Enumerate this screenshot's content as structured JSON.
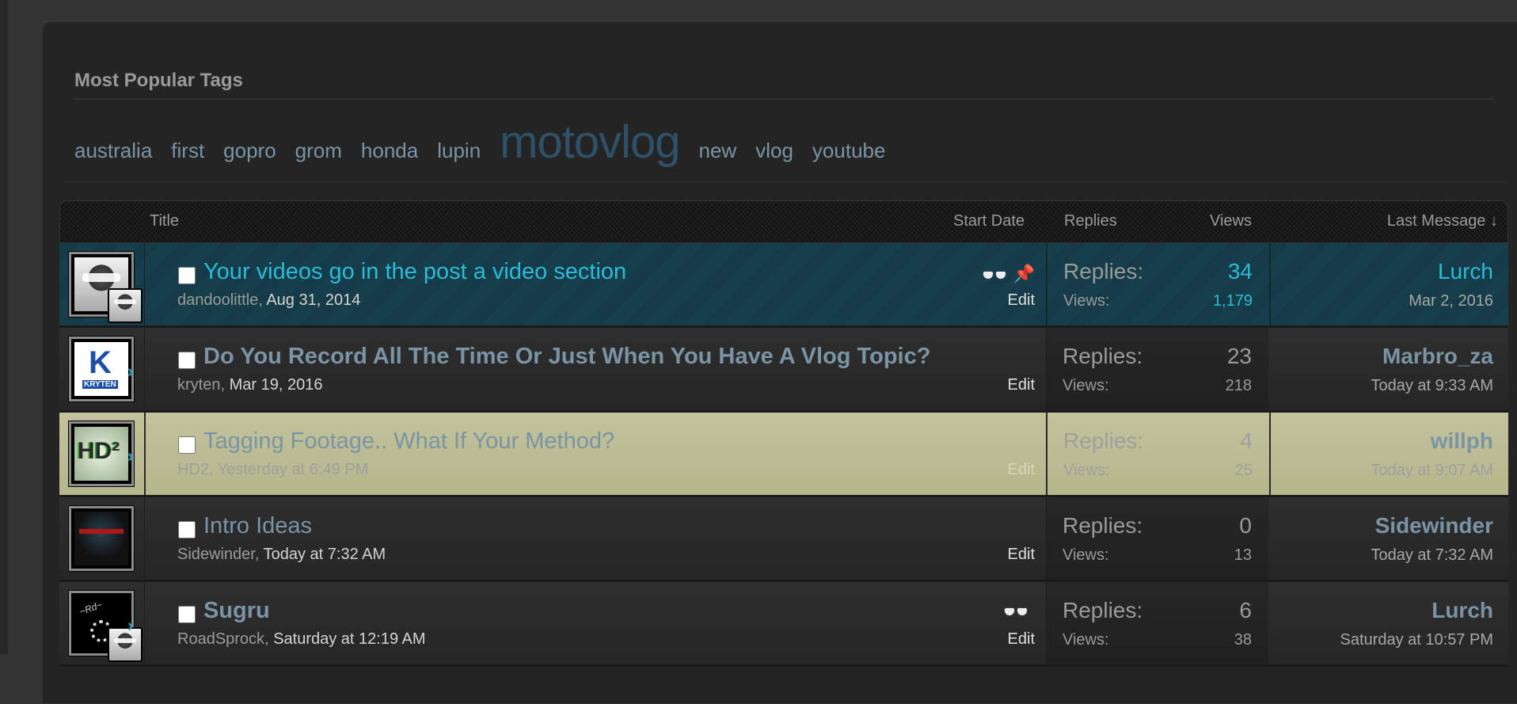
{
  "tags": {
    "heading": "Most Popular Tags",
    "items": [
      {
        "label": "australia",
        "size": "normal"
      },
      {
        "label": "first",
        "size": "normal"
      },
      {
        "label": "gopro",
        "size": "normal"
      },
      {
        "label": "grom",
        "size": "normal"
      },
      {
        "label": "honda",
        "size": "normal"
      },
      {
        "label": "lupin",
        "size": "normal"
      },
      {
        "label": "motovlog",
        "size": "large"
      },
      {
        "label": "new",
        "size": "normal"
      },
      {
        "label": "vlog",
        "size": "normal"
      },
      {
        "label": "youtube",
        "size": "normal"
      }
    ]
  },
  "table": {
    "headers": {
      "title": "Title",
      "start_date": "Start Date",
      "replies": "Replies",
      "views": "Views",
      "last_message": "Last Message ↓"
    },
    "stat_labels": {
      "replies": "Replies:",
      "views": "Views:"
    },
    "edit_label": "Edit",
    "threads": [
      {
        "title": "Your videos go in the post a video section",
        "author": "dandoolittle",
        "start_date": "Aug 31, 2014",
        "replies": "34",
        "views": "1,179",
        "last_user": "Lurch",
        "last_date": "Mar 2, 2016",
        "state": "sticky",
        "icons": [
          "watched-icon",
          "sticky-pin-icon"
        ],
        "has_mini_avatar": true,
        "avatar": "helmet"
      },
      {
        "title": "Do You Record All The Time Or Just When You Have A Vlog Topic?",
        "author": "kryten",
        "start_date": "Mar 19, 2016",
        "replies": "23",
        "views": "218",
        "last_user": "Marbro_za",
        "last_date": "Today at 9:33 AM",
        "state": "unread",
        "icons": [],
        "has_mini_avatar": false,
        "avatar": "kryten"
      },
      {
        "title": "Tagging Footage.. What If Your Method?",
        "author": "HD2",
        "start_date": "Yesterday at 6:49 PM",
        "replies": "4",
        "views": "25",
        "last_user": "willph",
        "last_date": "Today at 9:07 AM",
        "state": "moderated",
        "icons": [],
        "has_mini_avatar": false,
        "avatar": "hd2"
      },
      {
        "title": "Intro Ideas",
        "author": "Sidewinder",
        "start_date": "Today at 7:32 AM",
        "replies": "0",
        "views": "13",
        "last_user": "Sidewinder",
        "last_date": "Today at 7:32 AM",
        "state": "read",
        "icons": [],
        "has_mini_avatar": false,
        "avatar": "sidewinder"
      },
      {
        "title": "Sugru",
        "author": "RoadSprock",
        "start_date": "Saturday at 12:19 AM",
        "replies": "6",
        "views": "38",
        "last_user": "Lurch",
        "last_date": "Saturday at 10:57 PM",
        "state": "unread",
        "icons": [
          "watched-icon"
        ],
        "has_mini_avatar": true,
        "avatar": "sprocket"
      }
    ]
  },
  "colors": {
    "sticky_bg": "#163b48",
    "sticky_text": "#2bbbd8",
    "moderated_bg": "#bfc098",
    "link": "#7a94a6",
    "tag_large": "#2e5068"
  }
}
